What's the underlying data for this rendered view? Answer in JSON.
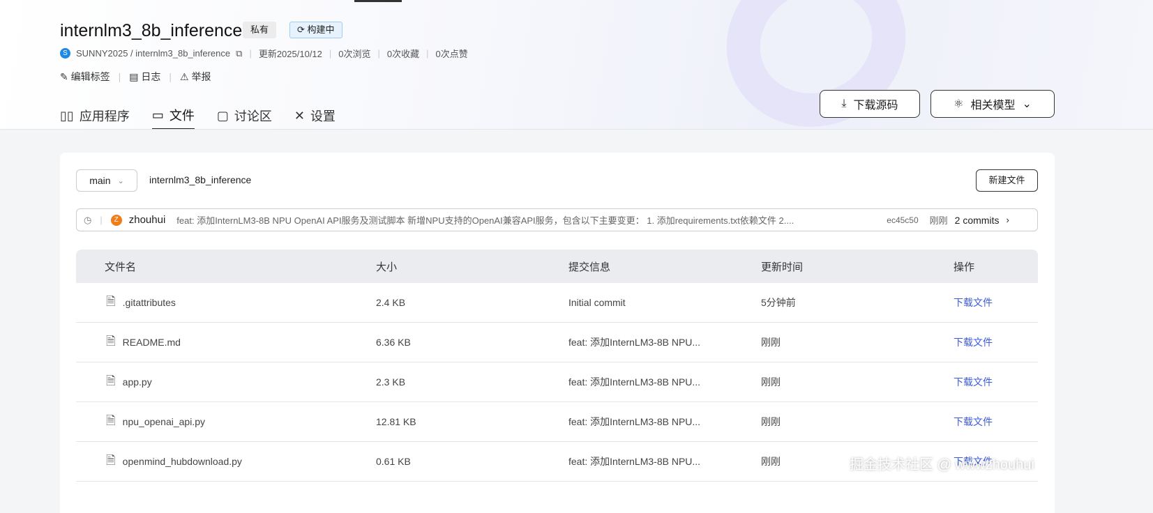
{
  "header": {
    "title": "internlm3_8b_inference",
    "badge_private": "私有",
    "badge_status": "构建中",
    "owner_initial": "S",
    "breadcrumb": "SUNNY2025 / internlm3_8b_inference",
    "updated": "更新2025/10/12",
    "views": "0次浏览",
    "favorites": "0次收藏",
    "likes": "0次点赞",
    "edit_tags": "编辑标签",
    "log": "日志",
    "report": "举报"
  },
  "tabs": [
    {
      "label": "应用程序"
    },
    {
      "label": "文件"
    },
    {
      "label": "讨论区"
    },
    {
      "label": "设置"
    }
  ],
  "buttons": {
    "download_source": "下载源码",
    "related_models": "相关模型",
    "new_file": "新建文件"
  },
  "repo": {
    "branch": "main",
    "path": "internlm3_8b_inference"
  },
  "commit": {
    "author_initial": "Z",
    "author": "zhouhui",
    "message": "feat: 添加InternLM3-8B NPU OpenAI API服务及测试脚本 新增NPU支持的OpenAI兼容API服务，包含以下主要变更： 1. 添加requirements.txt依赖文件 2....",
    "hash": "ec45c50",
    "time": "刚刚",
    "count": "2 commits"
  },
  "table": {
    "headers": [
      "文件名",
      "大小",
      "提交信息",
      "更新时间",
      "操作"
    ],
    "rows": [
      {
        "name": ".gitattributes",
        "size": "2.4 KB",
        "message": "Initial commit",
        "time": "5分钟前",
        "action": "下载文件"
      },
      {
        "name": "README.md",
        "size": "6.36 KB",
        "message": "feat: 添加InternLM3-8B NPU...",
        "time": "刚刚",
        "action": "下载文件"
      },
      {
        "name": "app.py",
        "size": "2.3 KB",
        "message": "feat: 添加InternLM3-8B NPU...",
        "time": "刚刚",
        "action": "下载文件"
      },
      {
        "name": "npu_openai_api.py",
        "size": "12.81 KB",
        "message": "feat: 添加InternLM3-8B NPU...",
        "time": "刚刚",
        "action": "下载文件"
      },
      {
        "name": "openmind_hubdownload.py",
        "size": "0.61 KB",
        "message": "feat: 添加InternLM3-8B NPU...",
        "time": "刚刚",
        "action": "下载文件"
      }
    ]
  },
  "watermark": "掘金技术社区 @ wwwzhouhui"
}
